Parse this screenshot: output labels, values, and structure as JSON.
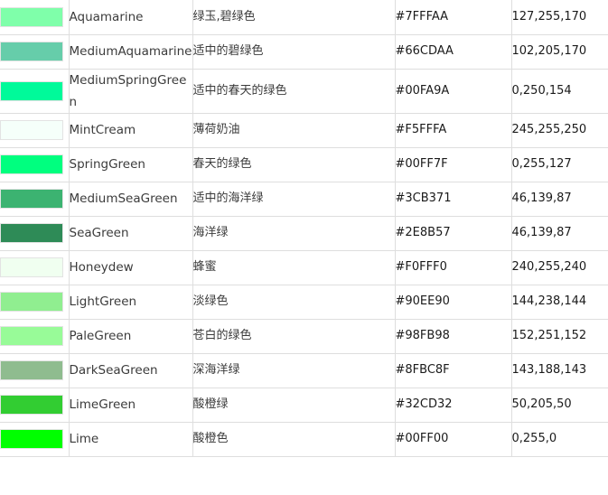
{
  "table": {
    "columns": [
      "swatch",
      "name",
      "chinese_name",
      "hex",
      "rgb"
    ],
    "border_color": "#dedede",
    "swatch_border_color": "#e3e3e3",
    "rows": [
      {
        "swatch_color": "#7FFFAA",
        "name": "Aquamarine",
        "chinese_name": "绿玉,碧绿色",
        "hex": "#7FFFAA",
        "rgb": "127,255,170"
      },
      {
        "swatch_color": "#66CDAA",
        "name": "MediumAquamarine",
        "chinese_name": "适中的碧绿色",
        "hex": "#66CDAA",
        "rgb": "102,205,170"
      },
      {
        "swatch_color": "#00FA9A",
        "name": "MediumSpringGreen",
        "chinese_name": "适中的春天的绿色",
        "hex": "#00FA9A",
        "rgb": "0,250,154"
      },
      {
        "swatch_color": "#F5FFFA",
        "name": "MintCream",
        "chinese_name": "薄荷奶油",
        "hex": "#F5FFFA",
        "rgb": "245,255,250"
      },
      {
        "swatch_color": "#00FF7F",
        "name": "SpringGreen",
        "chinese_name": "春天的绿色",
        "hex": "#00FF7F",
        "rgb": "0,255,127"
      },
      {
        "swatch_color": "#3CB371",
        "name": "MediumSeaGreen",
        "chinese_name": "适中的海洋绿",
        "hex": "#3CB371",
        "rgb": "46,139,87"
      },
      {
        "swatch_color": "#2E8B57",
        "name": "SeaGreen",
        "chinese_name": "海洋绿",
        "hex": "#2E8B57",
        "rgb": "46,139,87"
      },
      {
        "swatch_color": "#F0FFF0",
        "name": "Honeydew",
        "chinese_name": "蜂蜜",
        "hex": "#F0FFF0",
        "rgb": "240,255,240"
      },
      {
        "swatch_color": "#90EE90",
        "name": "LightGreen",
        "chinese_name": "淡绿色",
        "hex": "#90EE90",
        "rgb": "144,238,144"
      },
      {
        "swatch_color": "#98FB98",
        "name": "PaleGreen",
        "chinese_name": "苍白的绿色",
        "hex": "#98FB98",
        "rgb": "152,251,152"
      },
      {
        "swatch_color": "#8FBC8F",
        "name": "DarkSeaGreen",
        "chinese_name": "深海洋绿",
        "hex": "#8FBC8F",
        "rgb": "143,188,143"
      },
      {
        "swatch_color": "#32CD32",
        "name": "LimeGreen",
        "chinese_name": "酸橙绿",
        "hex": "#32CD32",
        "rgb": "50,205,50"
      },
      {
        "swatch_color": "#00FF00",
        "name": "Lime",
        "chinese_name": "酸橙色",
        "hex": "#00FF00",
        "rgb": "0,255,0"
      }
    ]
  }
}
